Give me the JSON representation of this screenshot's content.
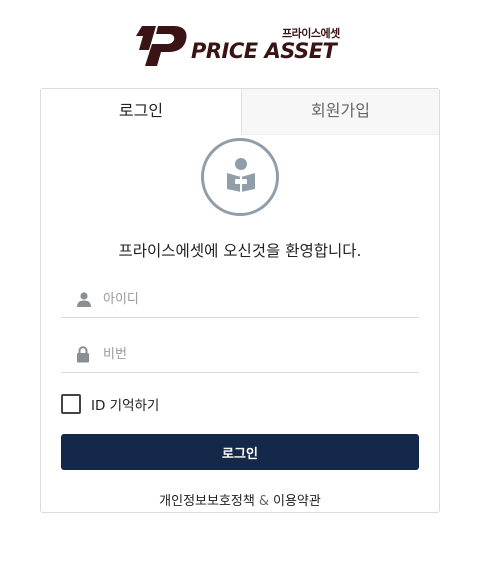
{
  "brand": {
    "name": "PRICE ASSET",
    "korean_name": "프라이스에셋",
    "color": "#3a1414"
  },
  "tabs": {
    "login": "로그인",
    "signup": "회원가입"
  },
  "welcome": "프라이스에셋에 오신것을 환영합니다.",
  "form": {
    "id_placeholder": "아이디",
    "password_placeholder": "비번",
    "remember_label": "ID 기억하기",
    "login_button": "로그인",
    "button_color": "#14284a"
  },
  "footer": {
    "privacy": "개인정보보호정책",
    "separator": "&",
    "terms": "이용약관"
  },
  "icons": [
    "user-icon",
    "lock-icon",
    "reader-icon"
  ]
}
